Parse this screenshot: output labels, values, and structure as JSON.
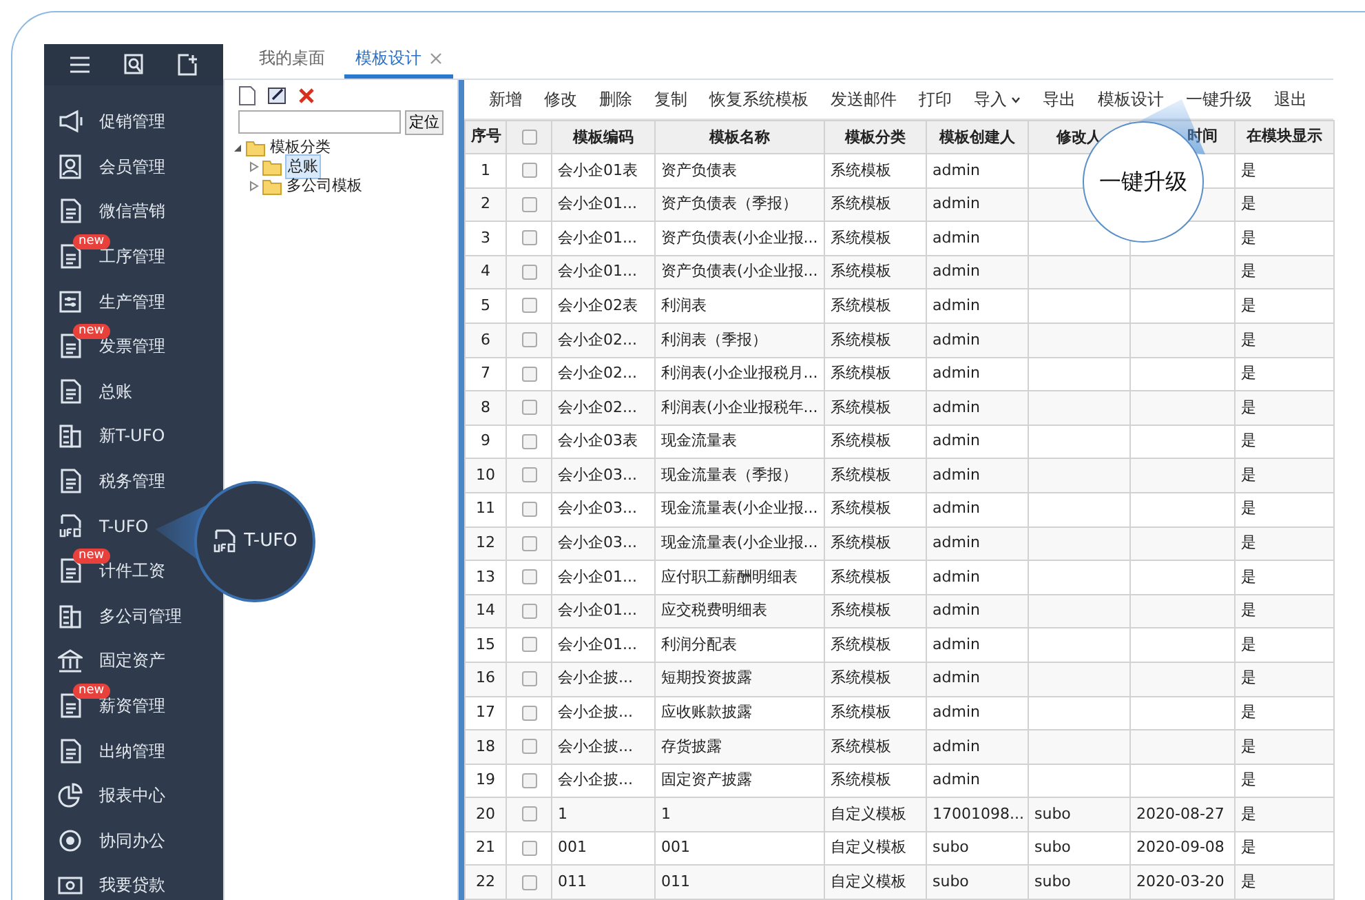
{
  "sidebar": {
    "items": [
      {
        "label": "促销管理"
      },
      {
        "label": "会员管理"
      },
      {
        "label": "微信营销"
      },
      {
        "label": "工序管理",
        "badge": "new"
      },
      {
        "label": "生产管理"
      },
      {
        "label": "发票管理",
        "badge": "new"
      },
      {
        "label": "总账"
      },
      {
        "label": "新T-UFO"
      },
      {
        "label": "税务管理"
      },
      {
        "label": "T-UFO"
      },
      {
        "label": "计件工资",
        "badge": "new"
      },
      {
        "label": "多公司管理"
      },
      {
        "label": "固定资产"
      },
      {
        "label": "薪资管理",
        "badge": "new"
      },
      {
        "label": "出纳管理"
      },
      {
        "label": "报表中心"
      },
      {
        "label": "协同办公"
      },
      {
        "label": "我要贷款"
      }
    ]
  },
  "tabs": [
    {
      "label": "我的桌面",
      "selected": false,
      "closable": false
    },
    {
      "label": "模板设计",
      "selected": true,
      "closable": true
    }
  ],
  "tree": {
    "locate_button": "定位",
    "nodes": [
      {
        "label": "模板分类",
        "expanded": true,
        "selected": false,
        "children": [
          {
            "label": "总账",
            "expanded": false,
            "selected": true
          },
          {
            "label": "多公司模板",
            "expanded": false,
            "selected": false
          }
        ]
      }
    ]
  },
  "toolbar": [
    {
      "label": "新增",
      "dropdown": false
    },
    {
      "label": "修改",
      "dropdown": false
    },
    {
      "label": "删除",
      "dropdown": false
    },
    {
      "label": "复制",
      "dropdown": false
    },
    {
      "label": "恢复系统模板",
      "dropdown": false
    },
    {
      "label": "发送邮件",
      "dropdown": false
    },
    {
      "label": "打印",
      "dropdown": false
    },
    {
      "label": "导入",
      "dropdown": true
    },
    {
      "label": "导出",
      "dropdown": false
    },
    {
      "label": "模板设计",
      "dropdown": false
    },
    {
      "label": "一键升级",
      "dropdown": false
    },
    {
      "label": "退出",
      "dropdown": false
    }
  ],
  "table": {
    "select_all_checked": false,
    "columns": [
      "序号",
      "",
      "模板编码",
      "模板名称",
      "模板分类",
      "模板创建人",
      "修改人",
      "时间",
      "在模块显示"
    ],
    "rows": [
      {
        "checked": false,
        "cells": [
          "1",
          "",
          "会小企01表",
          "资产负债表",
          "系统模板",
          "admin",
          "",
          "",
          "是"
        ]
      },
      {
        "checked": false,
        "cells": [
          "2",
          "",
          "会小企01...",
          "资产负债表（季报）",
          "系统模板",
          "admin",
          "",
          "",
          "是"
        ]
      },
      {
        "checked": false,
        "cells": [
          "3",
          "",
          "会小企01...",
          "资产负债表(小企业报...",
          "系统模板",
          "admin",
          "",
          "",
          "是"
        ]
      },
      {
        "checked": false,
        "cells": [
          "4",
          "",
          "会小企01...",
          "资产负债表(小企业报...",
          "系统模板",
          "admin",
          "",
          "",
          "是"
        ]
      },
      {
        "checked": false,
        "cells": [
          "5",
          "",
          "会小企02表",
          "利润表",
          "系统模板",
          "admin",
          "",
          "",
          "是"
        ]
      },
      {
        "checked": false,
        "cells": [
          "6",
          "",
          "会小企02...",
          "利润表（季报）",
          "系统模板",
          "admin",
          "",
          "",
          "是"
        ]
      },
      {
        "checked": false,
        "cells": [
          "7",
          "",
          "会小企02...",
          "利润表(小企业报税月...",
          "系统模板",
          "admin",
          "",
          "",
          "是"
        ]
      },
      {
        "checked": false,
        "cells": [
          "8",
          "",
          "会小企02...",
          "利润表(小企业报税年...",
          "系统模板",
          "admin",
          "",
          "",
          "是"
        ]
      },
      {
        "checked": false,
        "cells": [
          "9",
          "",
          "会小企03表",
          "现金流量表",
          "系统模板",
          "admin",
          "",
          "",
          "是"
        ]
      },
      {
        "checked": false,
        "cells": [
          "10",
          "",
          "会小企03...",
          "现金流量表（季报）",
          "系统模板",
          "admin",
          "",
          "",
          "是"
        ]
      },
      {
        "checked": false,
        "cells": [
          "11",
          "",
          "会小企03...",
          "现金流量表(小企业报...",
          "系统模板",
          "admin",
          "",
          "",
          "是"
        ]
      },
      {
        "checked": false,
        "cells": [
          "12",
          "",
          "会小企03...",
          "现金流量表(小企业报...",
          "系统模板",
          "admin",
          "",
          "",
          "是"
        ]
      },
      {
        "checked": false,
        "cells": [
          "13",
          "",
          "会小企01...",
          "应付职工薪酬明细表",
          "系统模板",
          "admin",
          "",
          "",
          "是"
        ]
      },
      {
        "checked": false,
        "cells": [
          "14",
          "",
          "会小企01...",
          "应交税费明细表",
          "系统模板",
          "admin",
          "",
          "",
          "是"
        ]
      },
      {
        "checked": false,
        "cells": [
          "15",
          "",
          "会小企01...",
          "利润分配表",
          "系统模板",
          "admin",
          "",
          "",
          "是"
        ]
      },
      {
        "checked": false,
        "cells": [
          "16",
          "",
          "会小企披...",
          "短期投资披露",
          "系统模板",
          "admin",
          "",
          "",
          "是"
        ]
      },
      {
        "checked": false,
        "cells": [
          "17",
          "",
          "会小企披...",
          "应收账款披露",
          "系统模板",
          "admin",
          "",
          "",
          "是"
        ]
      },
      {
        "checked": false,
        "cells": [
          "18",
          "",
          "会小企披...",
          "存货披露",
          "系统模板",
          "admin",
          "",
          "",
          "是"
        ]
      },
      {
        "checked": false,
        "cells": [
          "19",
          "",
          "会小企披...",
          "固定资产披露",
          "系统模板",
          "admin",
          "",
          "",
          "是"
        ]
      },
      {
        "checked": false,
        "cells": [
          "20",
          "",
          "1",
          "1",
          "自定义模板",
          "17001098...",
          "subo",
          "2020-08-27",
          "是"
        ]
      },
      {
        "checked": false,
        "cells": [
          "21",
          "",
          "001",
          "001",
          "自定义模板",
          "subo",
          "subo",
          "2020-09-08",
          "是"
        ]
      },
      {
        "checked": false,
        "cells": [
          "22",
          "",
          "011",
          "011",
          "自定义模板",
          "subo",
          "subo",
          "2020-03-20",
          "是"
        ]
      }
    ]
  },
  "callouts": [
    {
      "kind": "icon-label",
      "label": "T-UFO"
    },
    {
      "kind": "text",
      "label": "一键升级"
    }
  ]
}
